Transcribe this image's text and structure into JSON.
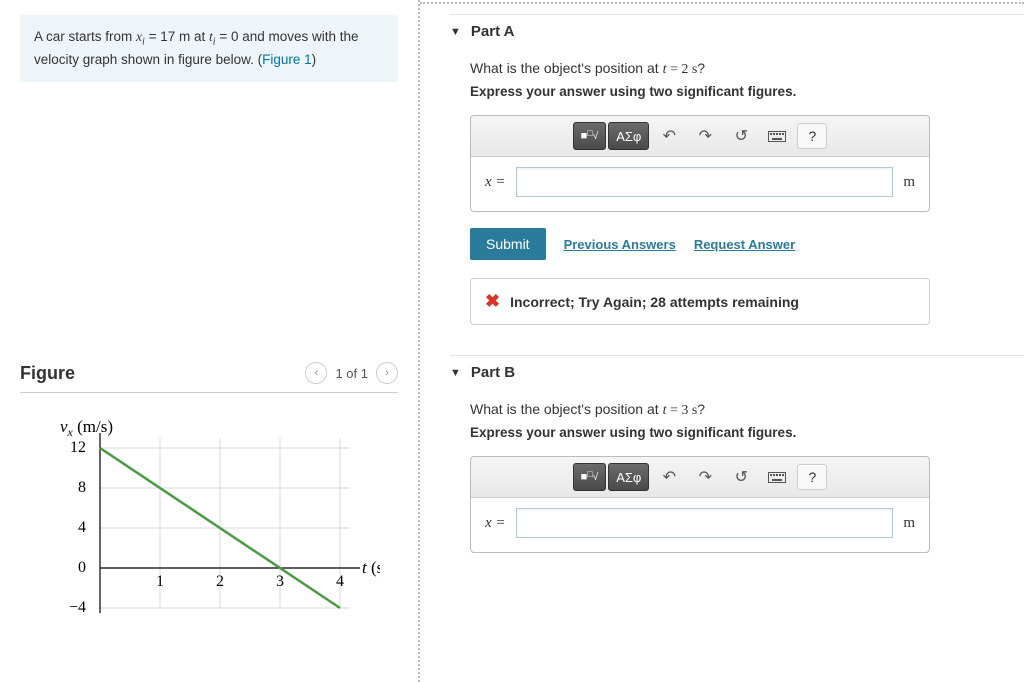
{
  "problem": {
    "text_prefix": "A car starts from ",
    "xi_sym": "x",
    "xi_sub": "i",
    "eq1": " = 17 m at ",
    "ti_sym": "t",
    "ti_sub": "i",
    "eq2": " = 0 and moves with the velocity graph shown in figure below. (",
    "fig_link": "Figure 1",
    "close": ")"
  },
  "figure": {
    "title": "Figure",
    "pager": "1 of 1",
    "ylabel_v": "v",
    "ylabel_sub": "x",
    "ylabel_unit": " (m/s)",
    "xlabel_t": "t",
    "xlabel_unit": " (s)"
  },
  "chart_data": {
    "type": "line",
    "title": "",
    "xlabel": "t (s)",
    "ylabel": "v_x (m/s)",
    "xlim": [
      0,
      4.2
    ],
    "ylim": [
      -4.5,
      13
    ],
    "x_ticks": [
      1,
      2,
      3,
      4
    ],
    "y_ticks": [
      -4,
      0,
      4,
      8,
      12
    ],
    "series": [
      {
        "name": "velocity",
        "x": [
          0,
          4
        ],
        "y": [
          12,
          -4
        ],
        "color": "#4a9b3f"
      }
    ]
  },
  "parts": [
    {
      "label": "Part A",
      "question_pre": "What is the object's position at ",
      "tvar": "t",
      "tval": " = 2 s",
      "question_post": "?",
      "instruction": "Express your answer using two significant figures.",
      "var": "x =",
      "unit": "m",
      "submit": "Submit",
      "prev": "Previous Answers",
      "req": "Request Answer",
      "feedback": "Incorrect; Try Again; 28 attempts remaining"
    },
    {
      "label": "Part B",
      "question_pre": "What is the object's position at ",
      "tvar": "t",
      "tval": " = 3 s",
      "question_post": "?",
      "instruction": "Express your answer using two significant figures.",
      "var": "x =",
      "unit": "m"
    }
  ],
  "toolbar": {
    "templates": "■√□",
    "greek": "ΑΣφ",
    "undo": "↶",
    "redo": "↷",
    "reset": "↺",
    "keyboard": "⌨",
    "help": "?"
  }
}
